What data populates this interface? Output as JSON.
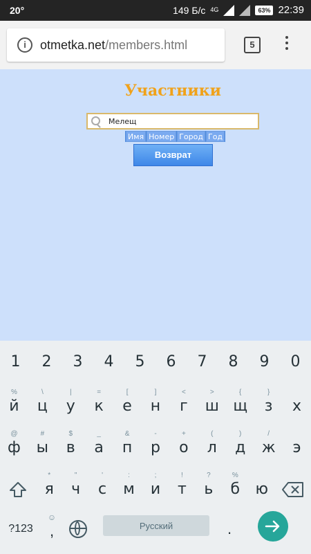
{
  "statusbar": {
    "temperature": "20°",
    "speed": "149 Б/с",
    "network": "4G",
    "battery": "63%",
    "time": "22:39"
  },
  "browser": {
    "url_host": "otmetka.net",
    "url_path": "/members.html",
    "tab_count": "5"
  },
  "page": {
    "title": "Участники",
    "search_value": "Мелещ",
    "sort_buttons": [
      "Имя",
      "Номер",
      "Город",
      "Год"
    ],
    "back_label": "Возврат"
  },
  "keyboard": {
    "row_numbers": [
      "1",
      "2",
      "3",
      "4",
      "5",
      "6",
      "7",
      "8",
      "9",
      "0"
    ],
    "row1": [
      "й",
      "ц",
      "у",
      "к",
      "е",
      "н",
      "г",
      "ш",
      "щ",
      "з",
      "х"
    ],
    "row1_hints": [
      "%",
      "\\",
      "|",
      "=",
      "[",
      "]",
      "<",
      ">",
      "{",
      "}",
      ""
    ],
    "row2": [
      "ф",
      "ы",
      "в",
      "а",
      "п",
      "р",
      "о",
      "л",
      "д",
      "ж",
      "э"
    ],
    "row2_hints": [
      "@",
      "#",
      "$",
      "_",
      "&",
      "-",
      "+",
      "(",
      ")",
      "/",
      ""
    ],
    "row3": [
      "я",
      "ч",
      "с",
      "м",
      "и",
      "т",
      "ь",
      "б",
      "ю"
    ],
    "row3_hints": [
      "*",
      "\"",
      "'",
      ":",
      ";",
      "!",
      "?",
      "%",
      ""
    ],
    "symbols_label": "?123",
    "comma": ",",
    "space_label": "Русский",
    "period": "."
  }
}
